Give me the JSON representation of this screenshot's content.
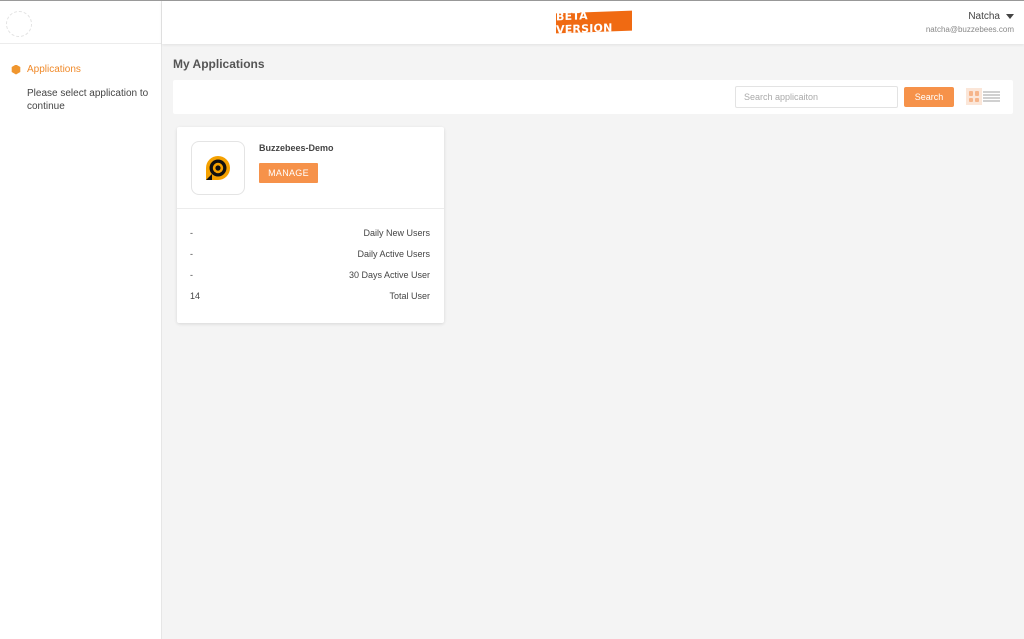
{
  "header": {
    "badge": "BETA VERSION",
    "user_name": "Natcha",
    "user_email": "natcha@buzzebees.com"
  },
  "sidebar": {
    "nav_label": "Applications",
    "hint": "Please select application to continue"
  },
  "main": {
    "title": "My Applications",
    "search": {
      "placeholder": "Search applicaiton",
      "value": "",
      "button_label": "Search"
    }
  },
  "apps": [
    {
      "name": "Buzzebees-Demo",
      "manage_label": "MANAGE",
      "stats": [
        {
          "value": "-",
          "label": "Daily New Users"
        },
        {
          "value": "-",
          "label": "Daily Active Users"
        },
        {
          "value": "-",
          "label": "30 Days Active User"
        },
        {
          "value": "14",
          "label": "Total User"
        }
      ]
    }
  ],
  "colors": {
    "accent": "#f6924a",
    "badge": "#f06a12",
    "app_icon": "#f5a100"
  },
  "icons": [
    "hexagon-icon",
    "caret-down-icon",
    "grid-view-icon",
    "list-view-icon",
    "app-logo-icon"
  ]
}
